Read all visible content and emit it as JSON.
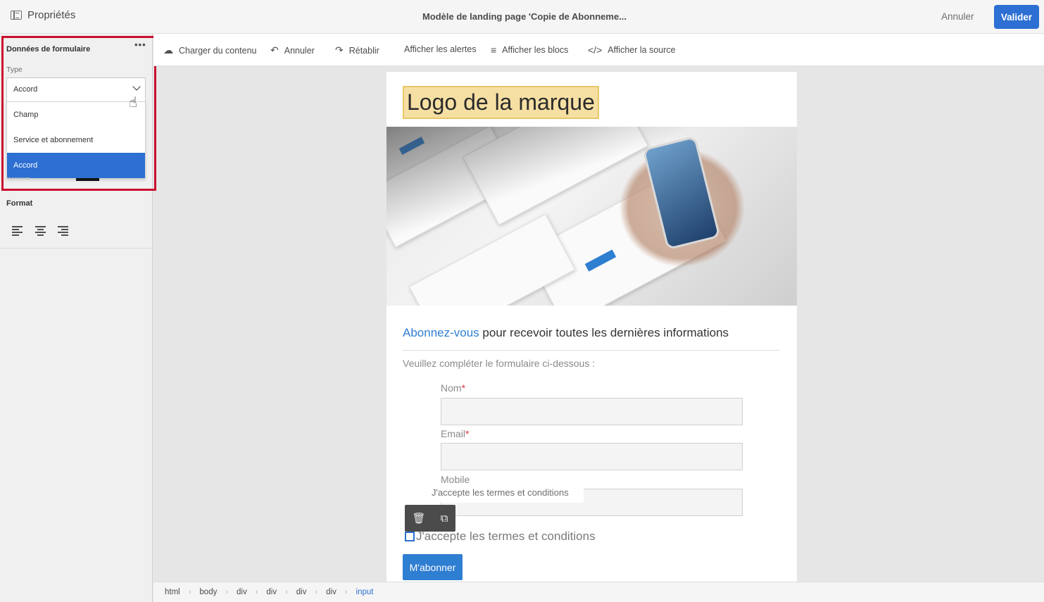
{
  "topbar": {
    "properties_label": "Propriétés",
    "title": "Modèle de landing page 'Copie de Abonneme...",
    "cancel_label": "Annuler",
    "validate_label": "Valider",
    "validate_color": "#2d6fd2"
  },
  "sidebar": {
    "section_title": "Données de formulaire",
    "more_label": "•••",
    "type_label": "Type",
    "type_value": "Accord",
    "options": [
      "Champ",
      "Service et abonnement",
      "Accord"
    ],
    "selected_option": "Accord",
    "format_title": "Format",
    "align_icons": [
      "align-left-icon",
      "align-center-icon",
      "align-right-icon"
    ],
    "highlight_color": "#c8102e"
  },
  "toolbar": {
    "items": [
      {
        "icon": "cloud-upload-icon",
        "glyph": "☁",
        "label": "Charger du contenu"
      },
      {
        "icon": "undo-icon",
        "glyph": "↶",
        "label": "Annuler"
      },
      {
        "icon": "redo-icon",
        "glyph": "↷",
        "label": "Rétablir"
      },
      {
        "icon": "",
        "glyph": "",
        "label": "Afficher les alertes"
      },
      {
        "icon": "blocks-icon",
        "glyph": "≡",
        "label": "Afficher les blocs"
      },
      {
        "icon": "code-icon",
        "glyph": "</>",
        "label": "Afficher la source"
      }
    ]
  },
  "canvas": {
    "logo_text": "Logo de la marque",
    "heading_accent": "Abonnez-vous",
    "heading_rest": " pour recevoir toutes les dernières informations",
    "intro": "Veuillez compléter le formulaire ci-dessous :",
    "fields": [
      {
        "label": "Nom",
        "required": "*"
      },
      {
        "label": "Email",
        "required": "*"
      },
      {
        "label": "Mobile",
        "required": ""
      }
    ],
    "inline_label": "J'accepte les termes et conditions",
    "checkbox_label": "J'accepte les termes et conditions",
    "submit_label": "M'abonner",
    "accent_color": "#2e7ed1"
  },
  "breadcrumb": [
    "html",
    "body",
    "div",
    "div",
    "div",
    "div",
    "input"
  ]
}
